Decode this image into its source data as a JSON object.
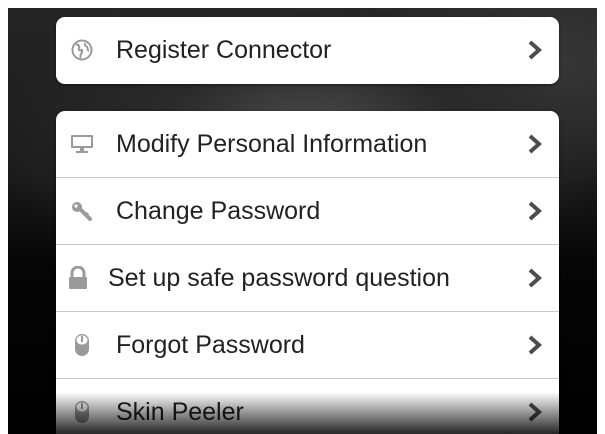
{
  "top_card": {
    "items": [
      {
        "label": "Register Connector",
        "icon": "globe-icon"
      }
    ]
  },
  "menu": {
    "items": [
      {
        "label": "Modify Personal Information",
        "icon": "monitor-icon"
      },
      {
        "label": "Change Password",
        "icon": "key-icon"
      },
      {
        "label": "Set up safe password question",
        "icon": "lock-icon"
      },
      {
        "label": "Forgot Password",
        "icon": "mouse-icon"
      },
      {
        "label": "Skin Peeler",
        "icon": "mouse-icon"
      }
    ]
  },
  "colors": {
    "card_bg": "#ffffff",
    "text": "#222222",
    "icon": "#9a9a9a",
    "chevron": "#4d4d4d",
    "divider": "#c9c9c9"
  }
}
